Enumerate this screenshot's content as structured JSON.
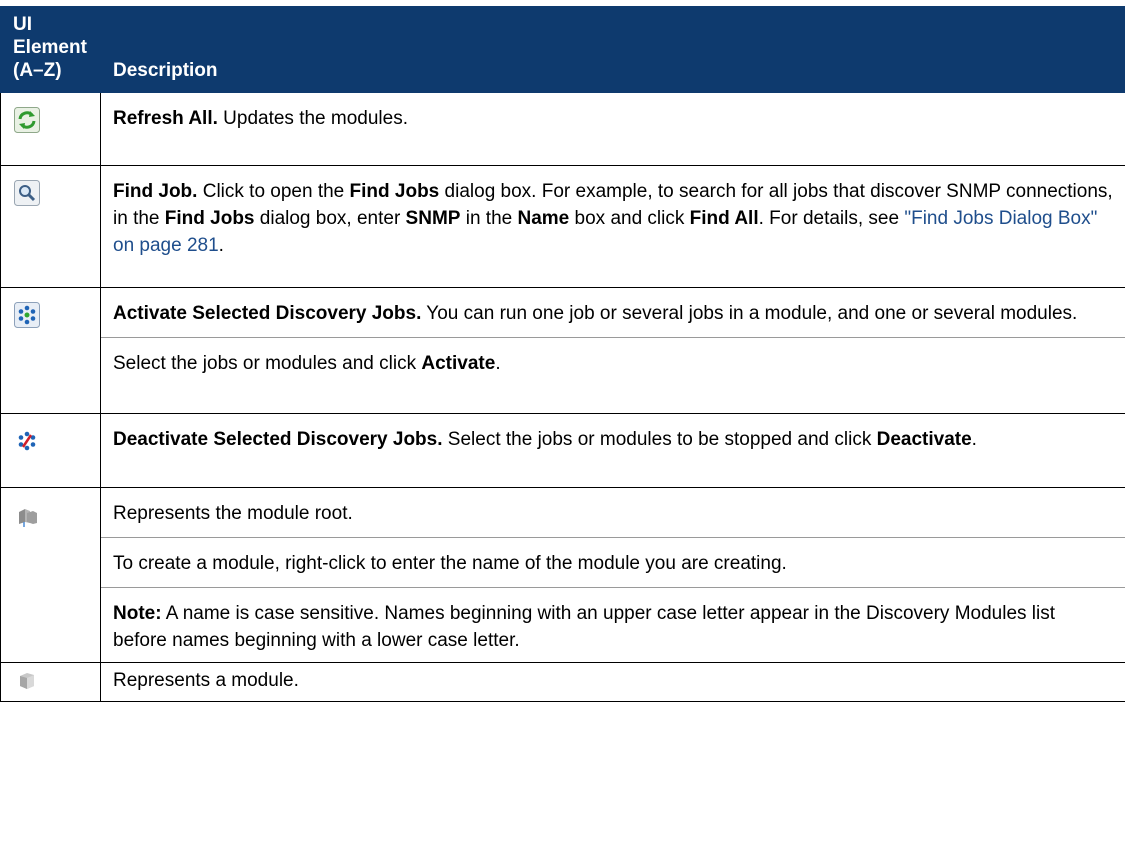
{
  "header": {
    "col1_line1": "UI",
    "col1_line2": "Element",
    "col1_line3": "(A–Z)",
    "col2": "Description"
  },
  "rows": [
    {
      "icon": "refresh-all-icon",
      "title": "Refresh All.",
      "text": " Updates the modules."
    },
    {
      "icon": "find-job-icon",
      "title": "Find Job.",
      "t1": " Click to open the ",
      "b1": "Find Jobs",
      "t2": " dialog box. For example, to search for all jobs that discover SNMP connections, in the ",
      "b2": "Find Jobs",
      "t3": " dialog box, enter ",
      "b3": "SNMP",
      "t4": " in the ",
      "b4": "Name",
      "t5": " box and click ",
      "b5": "Find All",
      "t6": ". For details, see ",
      "link": "\"Find Jobs Dialog Box\" on page 281",
      "t7": "."
    },
    {
      "icon": "activate-jobs-icon",
      "title": "Activate Selected Discovery Jobs.",
      "text": " You can run one job or several jobs in a module, and one or several modules.",
      "p2_t1": "Select the jobs or modules and click ",
      "p2_b1": "Activate",
      "p2_t2": "."
    },
    {
      "icon": "deactivate-jobs-icon",
      "title": "Deactivate Selected Discovery Jobs.",
      "t1": " Select the jobs or modules to be stopped and click ",
      "b1": "Deactivate",
      "t2": "."
    },
    {
      "icon": "module-root-icon",
      "p1": "Represents the module root.",
      "p2": "To create a module, right-click to enter the name of the module you are creating.",
      "note_label": "Note:",
      "note_text": " A name is case sensitive. Names beginning with an upper case letter appear in the Discovery Modules list before names beginning with a lower case letter."
    },
    {
      "icon": "module-icon",
      "p1": "Represents a module."
    }
  ],
  "colors": {
    "header_bg": "#0e3a6e",
    "link": "#1f4e8c"
  }
}
